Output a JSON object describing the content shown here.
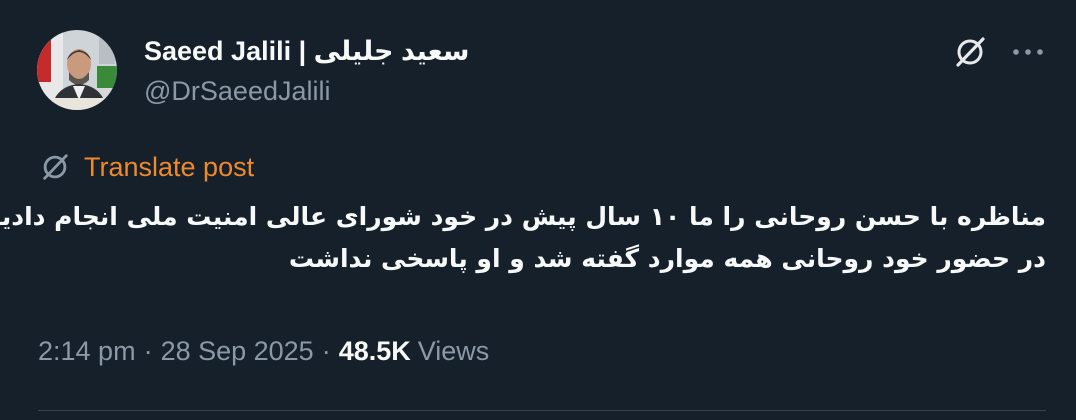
{
  "author": {
    "display_name": "Saeed Jalili | سعید جلیلی",
    "handle": "@DrSaeedJalili"
  },
  "header": {
    "grok_icon": "grok-icon",
    "more_icon": "more-horizontal-icon"
  },
  "translate": {
    "label": "Translate post",
    "icon": "translate-icon"
  },
  "post": {
    "lines": [
      "مناظره با حسن روحانی را ما ۱۰ سال پیش در خود شورای عالی امنیت ملی انجام دادیم؛",
      "در حضور خود روحانی همه موارد گفته شد و او پاسخی نداشت"
    ]
  },
  "meta": {
    "time": "2:14 pm",
    "separator": "·",
    "date": "28 Sep 2025",
    "views_count": "48.5K",
    "views_label": "Views"
  },
  "colors": {
    "background": "#15202b",
    "text_primary": "#f7f9f9",
    "text_secondary": "#8b98a5",
    "translate_accent": "#ef8a2c",
    "divider": "#38444d"
  }
}
